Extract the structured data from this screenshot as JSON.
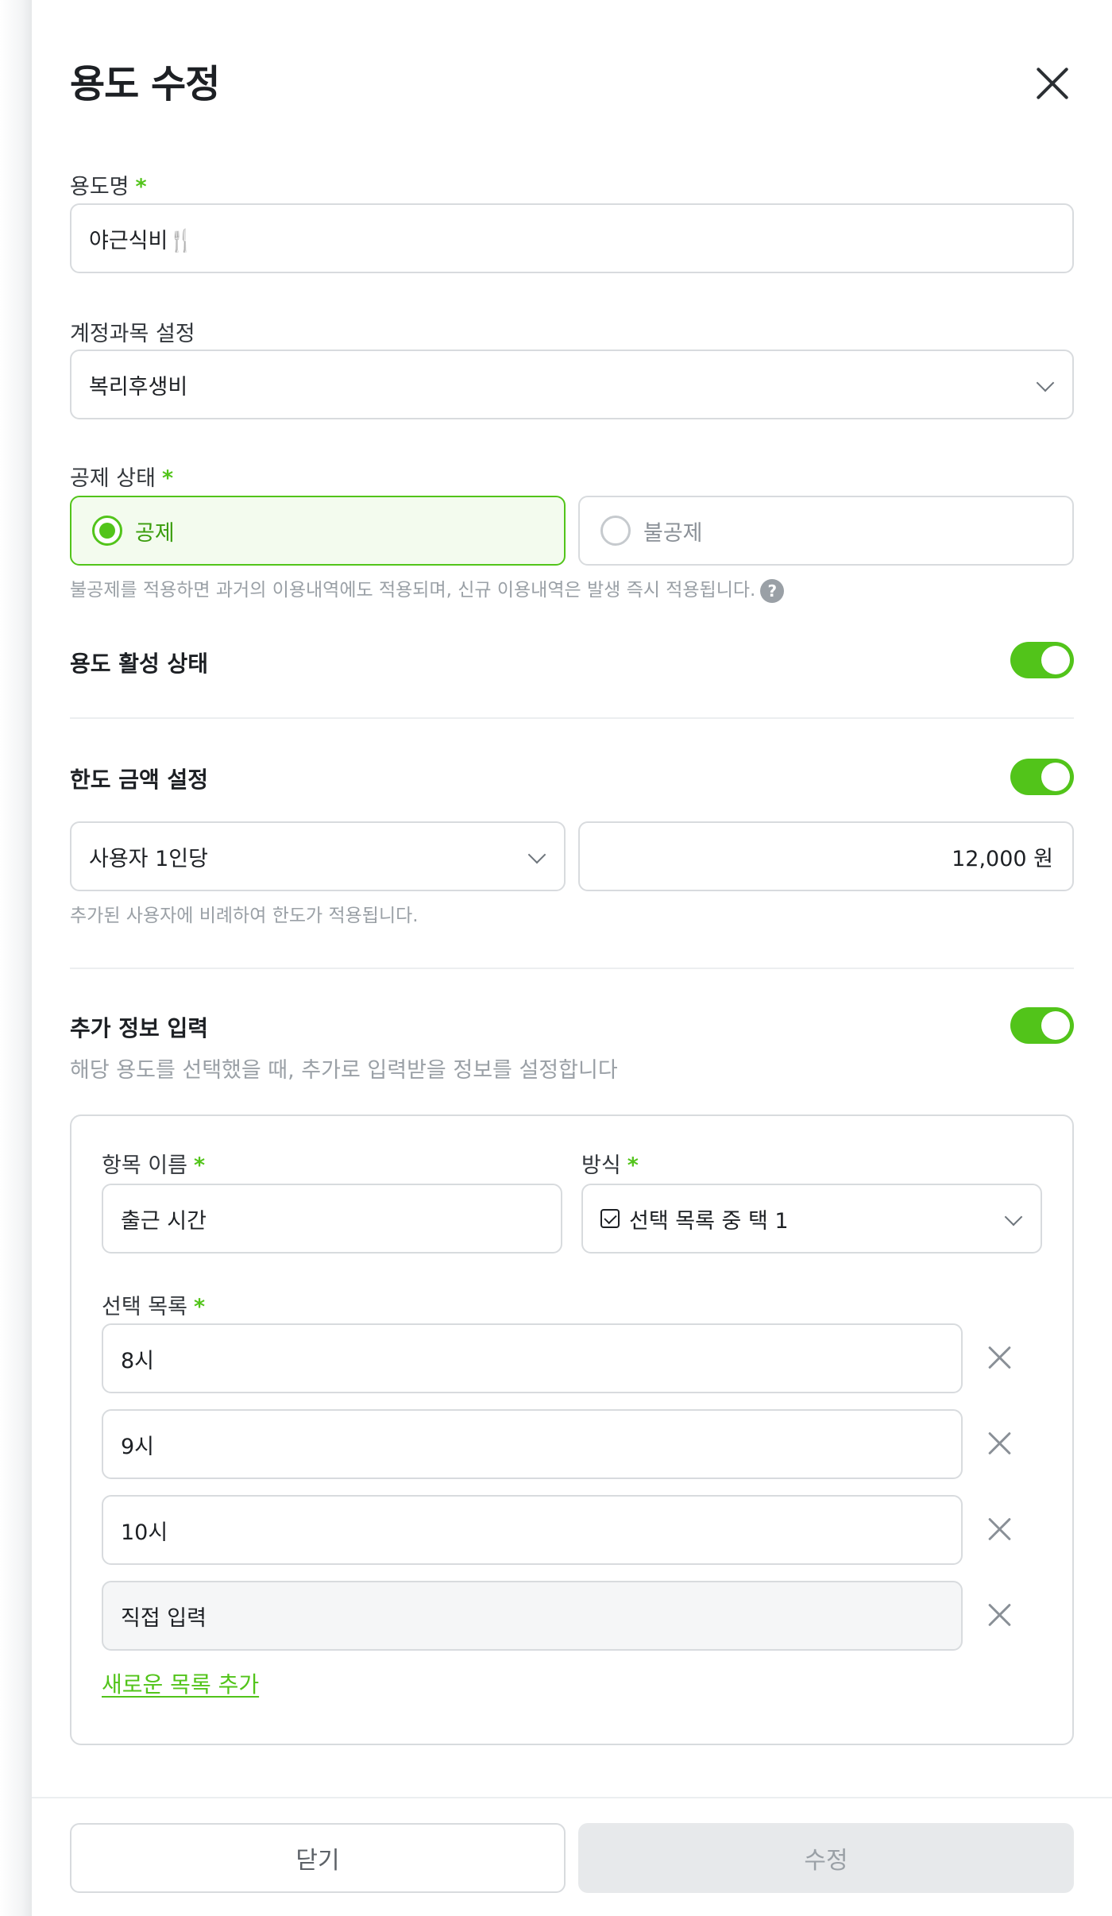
{
  "header": {
    "title": "용도 수정"
  },
  "purpose_name": {
    "label": "용도명",
    "required": "*",
    "value": "야근식비🍴"
  },
  "account": {
    "label": "계정과목 설정",
    "value": "복리후생비"
  },
  "deduction": {
    "label": "공제 상태",
    "required": "*",
    "options": [
      "공제",
      "불공제"
    ],
    "selected": "공제",
    "hint": "불공제를 적용하면 과거의 이용내역에도 적용되며, 신규 이용내역은 발생 즉시 적용됩니다.",
    "help_icon": "?"
  },
  "active": {
    "label": "용도 활성 상태",
    "enabled": true
  },
  "limit": {
    "label": "한도 금액 설정",
    "enabled": true,
    "basis": "사용자 1인당",
    "amount": "12,000 원",
    "hint": "추가된 사용자에 비례하여 한도가 적용됩니다."
  },
  "extra": {
    "label": "추가 정보 입력",
    "enabled": true,
    "desc": "해당 용도를 선택했을 때, 추가로 입력받을 정보를 설정합니다",
    "item_name_label": "항목 이름",
    "item_name_value": "출근 시간",
    "method_label": "방식",
    "method_value": "선택 목록 중 택 1",
    "choices_label": "선택 목록",
    "required": "*",
    "choices": [
      "8시",
      "9시",
      "10시",
      "직접 입력"
    ],
    "add_link": "새로운 목록 추가"
  },
  "footer": {
    "close_label": "닫기",
    "submit_label": "수정"
  },
  "colors": {
    "accent": "#52c41a",
    "border": "#d8dbde",
    "muted": "#9aa0a6"
  }
}
